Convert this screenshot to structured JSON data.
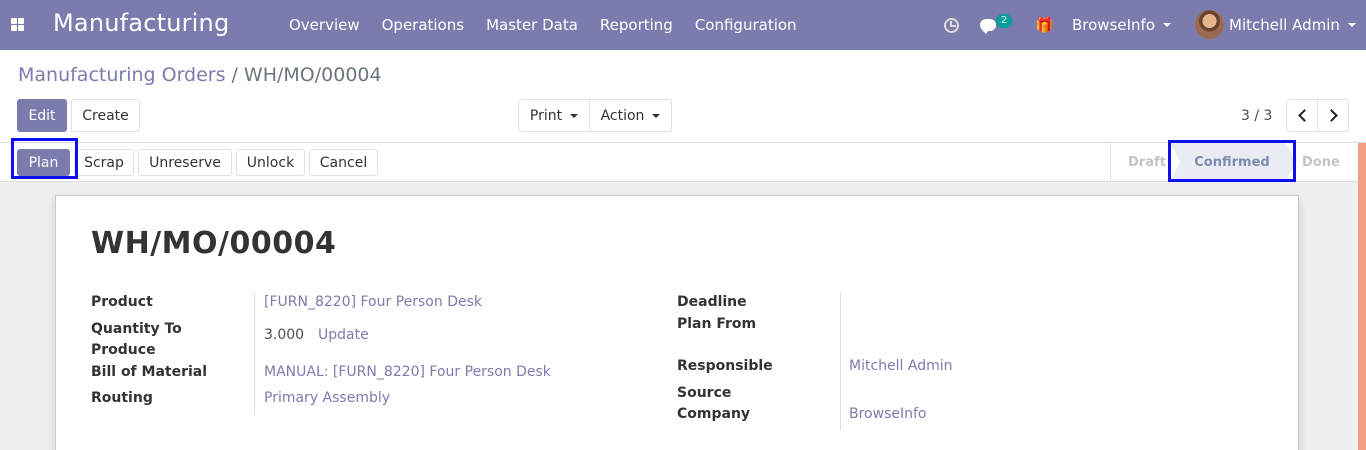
{
  "navbar": {
    "app_title": "Manufacturing",
    "menu": [
      "Overview",
      "Operations",
      "Master Data",
      "Reporting",
      "Configuration"
    ],
    "message_count": "2",
    "company": "BrowseInfo",
    "user": "Mitchell Admin",
    "color": "#7c7bad"
  },
  "breadcrumb": {
    "parent": "Manufacturing Orders",
    "separator": "/",
    "current": "WH/MO/00004"
  },
  "toolbar": {
    "edit": "Edit",
    "create": "Create",
    "print": "Print",
    "action": "Action",
    "pager": "3 / 3"
  },
  "statusbar": {
    "buttons": [
      "Plan",
      "Scrap",
      "Unreserve",
      "Unlock",
      "Cancel"
    ],
    "stages": [
      "Draft",
      "Confirmed",
      "Done"
    ],
    "active_stage": "Confirmed"
  },
  "form": {
    "title": "WH/MO/00004",
    "left": {
      "product_label": "Product",
      "product": "[FURN_8220] Four Person Desk",
      "qty_label_1": "Quantity To",
      "qty_label_2": "Produce",
      "qty": "3.000",
      "update": "Update",
      "bom_label": "Bill of Material",
      "bom": "MANUAL: [FURN_8220] Four Person Desk",
      "routing_label": "Routing",
      "routing": "Primary Assembly"
    },
    "right": {
      "deadline_label": "Deadline",
      "plan_from_label": "Plan From",
      "responsible_label": "Responsible",
      "responsible": "Mitchell Admin",
      "source_label": "Source",
      "company_label": "Company",
      "company": "BrowseInfo"
    }
  }
}
